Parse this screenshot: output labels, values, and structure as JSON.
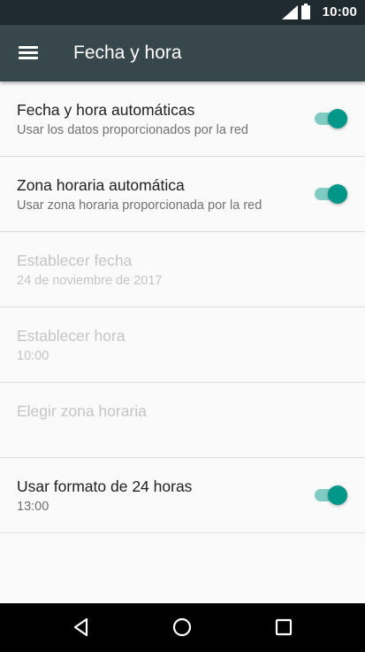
{
  "status_bar": {
    "time": "10:00",
    "icons": [
      "signal-icon",
      "battery-icon"
    ]
  },
  "app_bar": {
    "menu_icon": "menu-icon",
    "title": "Fecha y hora"
  },
  "settings": [
    {
      "title": "Fecha y hora automáticas",
      "subtitle": "Usar los datos proporcionados por la red",
      "toggle": true,
      "enabled": true
    },
    {
      "title": "Zona horaria automática",
      "subtitle": "Usar zona horaria proporcionada por la red",
      "toggle": true,
      "enabled": true
    },
    {
      "title": "Establecer fecha",
      "subtitle": "24 de noviembre de 2017",
      "toggle": null,
      "enabled": false
    },
    {
      "title": "Establecer hora",
      "subtitle": "10:00",
      "toggle": null,
      "enabled": false
    },
    {
      "title": "Elegir zona horaria",
      "subtitle": "",
      "toggle": null,
      "enabled": false
    },
    {
      "title": "Usar formato de 24 horas",
      "subtitle": "13:00",
      "toggle": true,
      "enabled": true
    }
  ],
  "nav_bar": {
    "buttons": [
      "back-icon",
      "home-icon",
      "recents-icon"
    ]
  },
  "colors": {
    "status_bar": "#1f2a2e",
    "app_bar": "#37474b",
    "accent": "#009688",
    "accent_track": "#80cbc4",
    "disabled_text": "#c5c5c5"
  }
}
